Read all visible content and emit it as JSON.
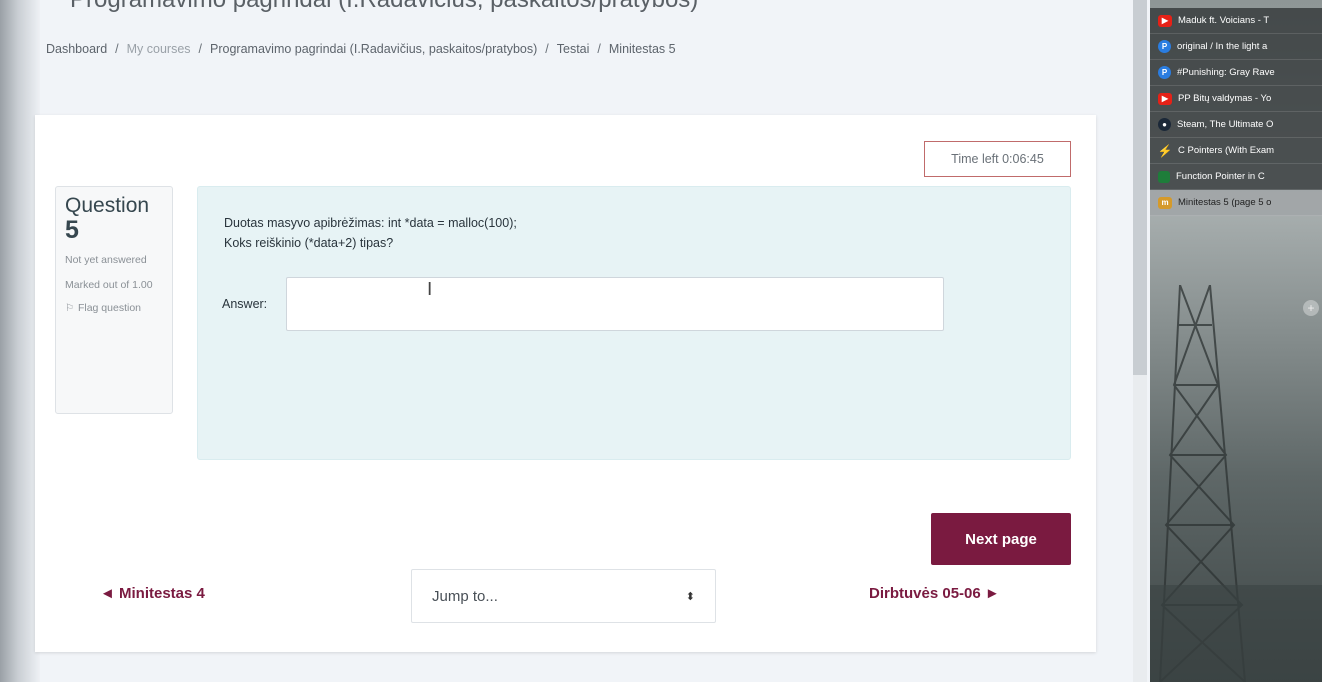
{
  "page": {
    "title": "Programavimo pagrindai (I.Radavičius, paskaitos/pratybos)"
  },
  "breadcrumb": {
    "items": [
      "Dashboard",
      "My courses",
      "Programavimo pagrindai (I.Radavičius, paskaitos/pratybos)",
      "Testai",
      "Minitestas 5"
    ],
    "separator": "/"
  },
  "timer": {
    "label": "Time left 0:06:45"
  },
  "question": {
    "label": "Question",
    "number": "5",
    "status": "Not yet answered",
    "marks": "Marked out of 1.00",
    "flag_label": "Flag question",
    "text_line1": "Duotas masyvo apibrėžimas: int *data = malloc(100);",
    "text_line2": "Koks reiškinio (*data+2) tipas?",
    "answer_label": "Answer:",
    "answer_value": ""
  },
  "navigation": {
    "next_page": "Next page",
    "prev_activity": "◄ Minitestas 4",
    "next_activity": "Dirbtuvės 05-06 ►",
    "jump_to": "Jump to...",
    "jump_chevron": "⬍"
  },
  "tabs": [
    {
      "icon": "youtube-icon",
      "label": "Maduk ft. Voicians - T"
    },
    {
      "icon": "pandora-icon",
      "label": "original / In the light a"
    },
    {
      "icon": "pandora-icon",
      "label": "#Punishing: Gray Rave"
    },
    {
      "icon": "youtube-icon",
      "label": "PP Bitų valdymas - Yo"
    },
    {
      "icon": "steam-icon",
      "label": "Steam, The Ultimate O"
    },
    {
      "icon": "c-pointers-icon",
      "label": "C Pointers (With Exam"
    },
    {
      "icon": "function-pointer-icon",
      "label": "Function Pointer in C"
    },
    {
      "icon": "moodle-icon",
      "label": "Minitestas 5 (page 5 o"
    }
  ],
  "colors": {
    "accent": "#7a1a40",
    "formulation_bg": "#e7f3f5",
    "timer_border": "#c06b6b"
  }
}
